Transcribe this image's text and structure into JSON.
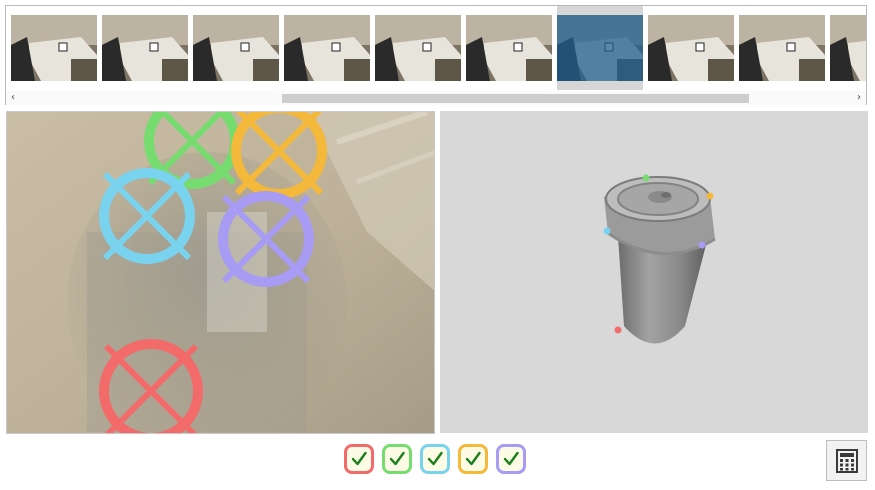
{
  "thumbnail_strip": {
    "thumbnails": [
      {
        "id": "frame-1",
        "selected": false
      },
      {
        "id": "frame-2",
        "selected": false
      },
      {
        "id": "frame-3",
        "selected": false
      },
      {
        "id": "frame-4",
        "selected": false
      },
      {
        "id": "frame-5",
        "selected": false
      },
      {
        "id": "frame-6",
        "selected": false
      },
      {
        "id": "frame-7",
        "selected": true
      },
      {
        "id": "frame-8",
        "selected": false
      },
      {
        "id": "frame-9",
        "selected": false
      },
      {
        "id": "frame-10",
        "selected": false
      }
    ],
    "scroll_left_icon": "chevron-left-icon",
    "scroll_right_icon": "chevron-right-icon",
    "left_arrow": "‹",
    "right_arrow": "›",
    "selected_overlay_color": "#1f5f8f"
  },
  "keypoints": [
    {
      "name": "keypoint-red",
      "color": "#f26a6a",
      "confirmed": true
    },
    {
      "name": "keypoint-green",
      "color": "#77dc6f",
      "confirmed": true
    },
    {
      "name": "keypoint-blue",
      "color": "#79d3ee",
      "confirmed": true
    },
    {
      "name": "keypoint-orange",
      "color": "#f4b83b",
      "confirmed": true
    },
    {
      "name": "keypoint-purple",
      "color": "#a79bf3",
      "confirmed": true
    }
  ],
  "toolbar": {
    "calculator_icon": "calculator-icon"
  },
  "colors": {
    "check_mark": "#1a7f1a",
    "model_background": "#d8d8d8"
  }
}
